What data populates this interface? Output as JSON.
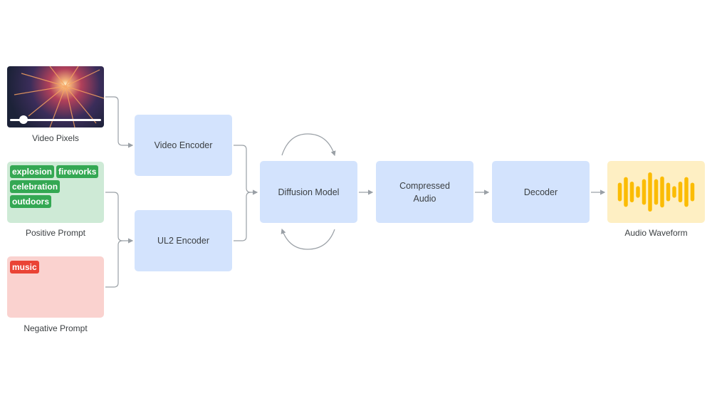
{
  "inputs": {
    "video": {
      "caption": "Video Pixels",
      "progress": 0.18
    },
    "positive_prompt": {
      "caption": "Positive Prompt",
      "tags": [
        "explosion",
        "fireworks",
        "celebration",
        "outdoors"
      ]
    },
    "negative_prompt": {
      "caption": "Negative Prompt",
      "tags": [
        "music"
      ]
    }
  },
  "nodes": {
    "video_encoder": "Video Encoder",
    "ul2_encoder": "UL2 Encoder",
    "diffusion_model": "Diffusion Model",
    "compressed_audio": "Compressed Audio",
    "decoder": "Decoder"
  },
  "output": {
    "caption": "Audio Waveform",
    "bar_levels": [
      0.45,
      0.72,
      0.5,
      0.28,
      0.62,
      0.95,
      0.62,
      0.75,
      0.45,
      0.28,
      0.5,
      0.72,
      0.45
    ]
  },
  "colors": {
    "node": "#d3e3fd",
    "positive": "#ceead6",
    "negative": "#fad2cf",
    "output": "#feefc3",
    "wave": "#fbbc04",
    "tag_pos": "#34a853",
    "tag_neg": "#ea4335",
    "line": "#9aa0a6"
  }
}
